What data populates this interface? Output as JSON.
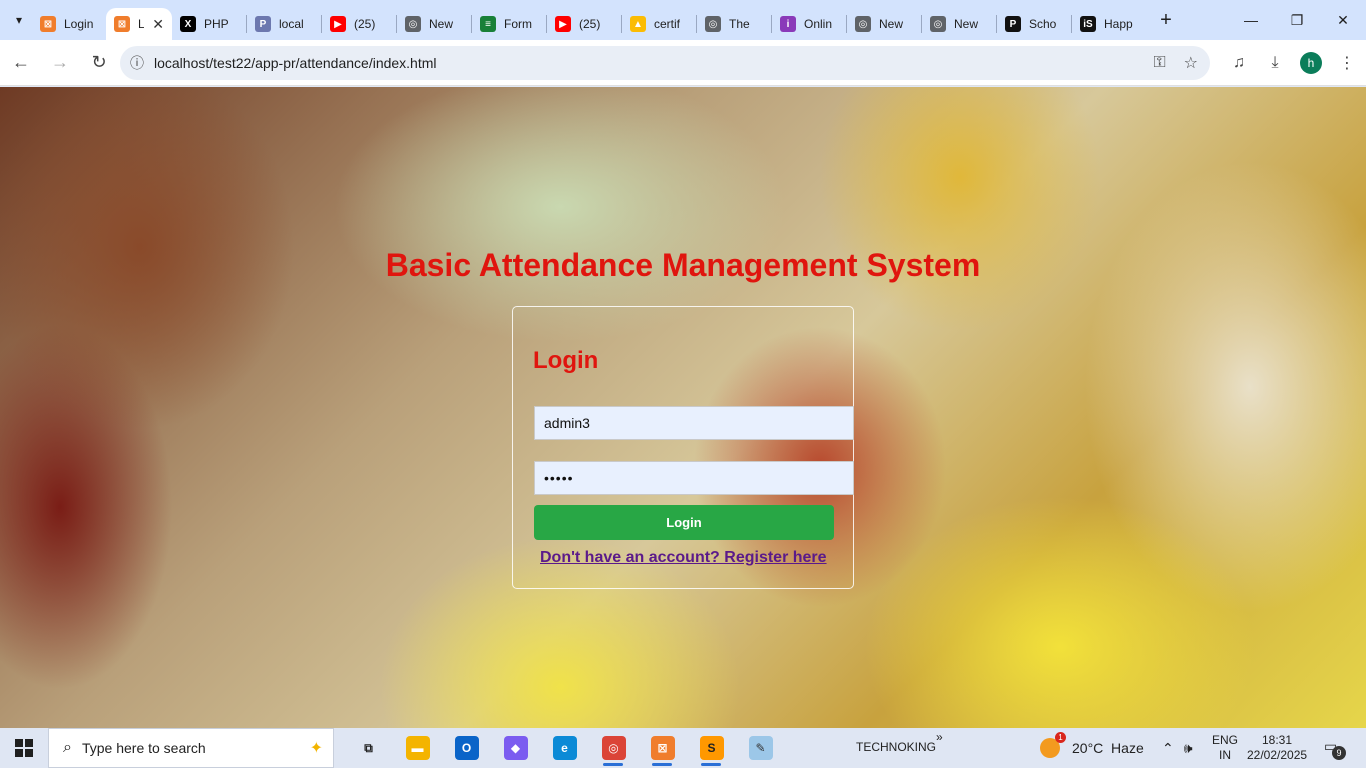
{
  "browser": {
    "tabs": [
      {
        "title": "Login",
        "favicon": "xampp-icon",
        "color": "#f07d2c",
        "active": false
      },
      {
        "title": "L",
        "favicon": "xampp-icon",
        "color": "#f07d2c",
        "active": true
      },
      {
        "title": "PHP",
        "favicon": "x-icon",
        "color": "#000000",
        "active": false
      },
      {
        "title": "local",
        "favicon": "phpmyadmin-icon",
        "color": "#6c78af",
        "active": false
      },
      {
        "title": "(25)",
        "favicon": "youtube-icon",
        "color": "#ff0000",
        "active": false
      },
      {
        "title": "New",
        "favicon": "globe-icon",
        "color": "#5f6368",
        "active": false
      },
      {
        "title": "Form",
        "favicon": "forms-icon",
        "color": "#188038",
        "active": false
      },
      {
        "title": "(25)",
        "favicon": "youtube-icon",
        "color": "#ff0000",
        "active": false
      },
      {
        "title": "certif",
        "favicon": "drive-icon",
        "color": "#fbbc04",
        "active": false
      },
      {
        "title": "The",
        "favicon": "globe-icon",
        "color": "#5f6368",
        "active": false
      },
      {
        "title": "Onlin",
        "favicon": "circle-icon",
        "color": "#8a3ab9",
        "active": false
      },
      {
        "title": "New",
        "favicon": "globe-icon",
        "color": "#5f6368",
        "active": false
      },
      {
        "title": "New",
        "favicon": "globe-icon",
        "color": "#5f6368",
        "active": false
      },
      {
        "title": "Scho",
        "favicon": "pexels-icon",
        "color": "#111111",
        "active": false
      },
      {
        "title": "Happ",
        "favicon": "istock-icon",
        "color": "#111111",
        "active": false
      }
    ],
    "close_glyph": "✕",
    "new_tab_glyph": "+",
    "url": "localhost/test22/app-pr/attendance/index.html",
    "profile_initial": "h"
  },
  "page": {
    "title": "Basic Attendance Management System",
    "login_heading": "Login",
    "username_value": "admin3",
    "password_value": "•••••",
    "login_button": "Login",
    "register_link": "Don't have an account? Register here",
    "accent_color": "#e0150e",
    "button_color": "#28a745"
  },
  "taskbar": {
    "search_placeholder": "Type here to search",
    "pinned_label": "TECHNOKING",
    "chevron": "»",
    "weather": "20°C  Haze",
    "weather_badge": "1",
    "lang_top": "ENG",
    "lang_bottom": "IN",
    "time": "18:31",
    "date": "22/02/2025",
    "notifications": "9",
    "apps": [
      {
        "name": "task-view-icon",
        "glyph": "⧉",
        "color": "#dfe6f3",
        "fg": "#222",
        "running": false
      },
      {
        "name": "file-explorer-icon",
        "glyph": "▬",
        "color": "#f4b400",
        "fg": "#fff",
        "running": false
      },
      {
        "name": "outlook-icon",
        "glyph": "O",
        "color": "#0a64c8",
        "fg": "#fff",
        "running": false
      },
      {
        "name": "copilot-icon",
        "glyph": "◆",
        "color": "#7b5cf0",
        "fg": "#fff",
        "running": false
      },
      {
        "name": "edge-icon",
        "glyph": "e",
        "color": "#0c8ad6",
        "fg": "#fff",
        "running": false
      },
      {
        "name": "chrome-icon",
        "glyph": "◎",
        "color": "#db4437",
        "fg": "#fff",
        "running": true
      },
      {
        "name": "xampp-icon",
        "glyph": "⊠",
        "color": "#f07d2c",
        "fg": "#fff",
        "running": true
      },
      {
        "name": "sublime-icon",
        "glyph": "S",
        "color": "#ff9800",
        "fg": "#222",
        "running": true
      },
      {
        "name": "paint-icon",
        "glyph": "✎",
        "color": "#9cc7e8",
        "fg": "#333",
        "running": false
      }
    ]
  }
}
